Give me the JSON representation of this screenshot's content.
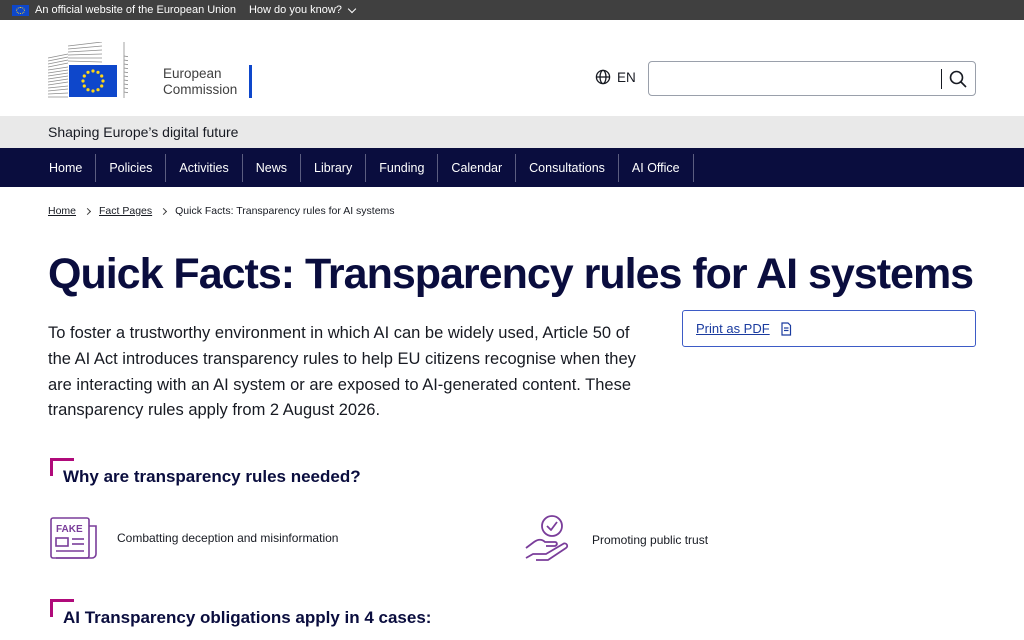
{
  "eu_bar": {
    "official_text": "An official website of the European Union",
    "know_text": "How do you know?"
  },
  "header": {
    "logo_line1": "European",
    "logo_line2": "Commission",
    "language": "EN",
    "search_value": "",
    "search_placeholder": ""
  },
  "site_name": "Shaping Europe’s digital future",
  "nav": {
    "items": [
      "Home",
      "Policies",
      "Activities",
      "News",
      "Library",
      "Funding",
      "Calendar",
      "Consultations",
      "AI Office"
    ]
  },
  "breadcrumb": {
    "items": [
      "Home",
      "Fact Pages"
    ],
    "current": "Quick Facts: Transparency rules for AI systems"
  },
  "page": {
    "title": "Quick Facts: Transparency rules for AI systems",
    "intro": "To foster a trustworthy environment in which AI can be widely used, Article 50 of the AI Act introduces transparency rules to help EU citizens recognise when they are interacting with an AI system or are exposed to AI-generated content. These transparency rules apply from 2 August 2026.",
    "print_label": "Print as PDF",
    "section1_title": "Why are transparency rules needed?",
    "reasons": [
      {
        "icon": "fake-news-icon",
        "label": "Combatting deception and misinformation",
        "badge": "FAKE"
      },
      {
        "icon": "trust-hand-icon",
        "label": "Promoting public trust"
      }
    ],
    "section2_title": "AI Transparency obligations apply in 4 cases:"
  },
  "colors": {
    "nav_bg": "#0a0d3e",
    "accent_magenta": "#b00a7a",
    "eu_blue": "#0e47cb",
    "icon_purple": "#7a3d9a"
  }
}
